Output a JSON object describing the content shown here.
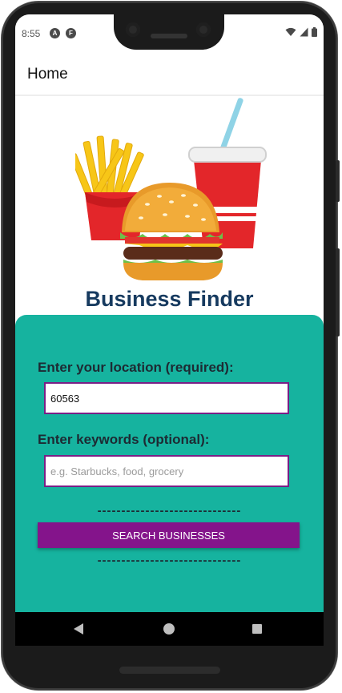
{
  "status_bar": {
    "time": "8:55",
    "app_icons": [
      "a-icon",
      "f-icon"
    ]
  },
  "app_bar": {
    "title": "Home"
  },
  "brand": {
    "name": "Business Finder"
  },
  "form": {
    "location_label": "Enter your location (required):",
    "location_value": "60563",
    "keywords_label": "Enter keywords (optional):",
    "keywords_value": "",
    "keywords_placeholder": "e.g. Starbucks, food, grocery",
    "divider_text": "------------------------------",
    "search_button_label": "SEARCH BUSINESSES"
  },
  "colors": {
    "card_background": "#16b39f",
    "button_background": "#84148b",
    "field_border": "#7a1f86",
    "brand_text": "#163a5f"
  }
}
